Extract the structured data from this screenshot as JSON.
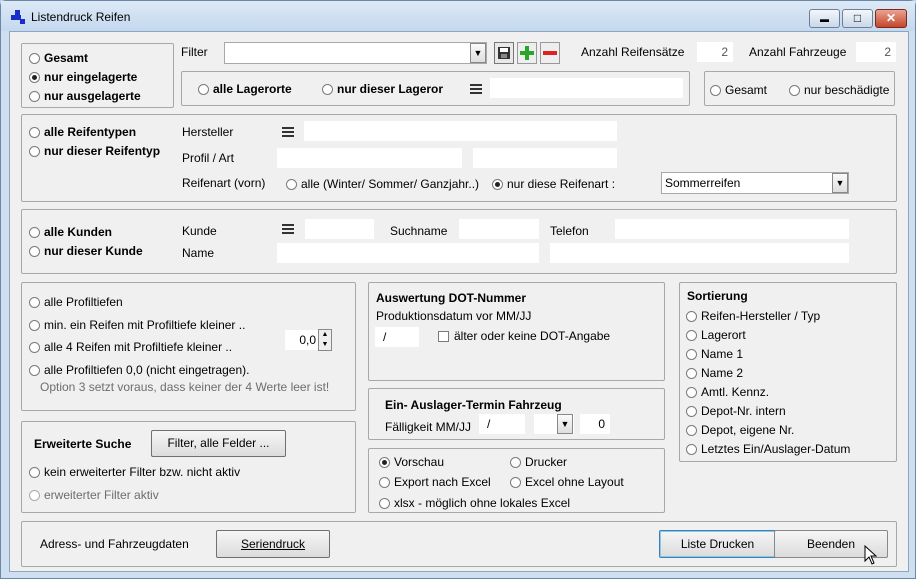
{
  "window": {
    "title": "Listendruck Reifen",
    "minimize": "▬",
    "maximize": "□",
    "close": "✕"
  },
  "scope": {
    "gesamt": "Gesamt",
    "eingelagert": "nur eingelagerte",
    "ausgelagert": "nur ausgelagerte",
    "selected": "eingelagert"
  },
  "filter": {
    "label": "Filter",
    "value": "",
    "save_icon": "floppy-disk",
    "add_icon": "plus",
    "remove_icon": "minus"
  },
  "counts": {
    "reifensaetze_label": "Anzahl Reifensätze",
    "reifensaetze_value": "2",
    "fahrzeuge_label": "Anzahl Fahrzeuge",
    "fahrzeuge_value": "2"
  },
  "lager": {
    "alle": "alle Lagerorte",
    "dieser": "nur dieser Lageror",
    "value": ""
  },
  "damage": {
    "gesamt": "Gesamt",
    "beschaedigt": "nur beschädigte"
  },
  "reifentyp": {
    "alle": "alle Reifentypen",
    "dieser": "nur dieser Reifentyp",
    "hersteller_label": "Hersteller",
    "profil_label": "Profil / Art",
    "reifenart_label": "Reifenart (vorn)",
    "alle_art": "alle (Winter/ Sommer/ Ganzjahr..)",
    "diese_art": "nur diese Reifenart :",
    "art_value": "Sommerreifen"
  },
  "kunden": {
    "alle": "alle Kunden",
    "dieser": "nur dieser Kunde",
    "kunde_label": "Kunde",
    "suchname_label": "Suchname",
    "telefon_label": "Telefon",
    "name_label": "Name"
  },
  "profil": {
    "alle": "alle Profiltiefen",
    "min_ein": "min. ein Reifen mit Profiltiefe kleiner ..",
    "alle4": "alle 4 Reifen mit Profiltiefe kleiner ..",
    "null": "alle Profiltiefen 0,0 (nicht eingetragen).",
    "hint": "Option 3 setzt voraus, dass keiner der 4 Werte leer ist!",
    "depth_value": "0,0"
  },
  "dot": {
    "title": "Auswertung DOT-Nummer",
    "sub": "Produktionsdatum vor MM/JJ",
    "value": "/",
    "older": "älter oder keine DOT-Angabe"
  },
  "termin": {
    "title": "Ein- Auslager-Termin Fahrzeug",
    "faellig_label": "Fälligkeit MM/JJ",
    "date_value": "/",
    "num_value": "0"
  },
  "sort": {
    "title": "Sortierung",
    "items": [
      "Reifen-Hersteller / Typ",
      "Lagerort",
      "Name 1",
      "Name 2",
      "Amtl. Kennz.",
      "Depot-Nr. intern",
      "Depot, eigene Nr.",
      "Letztes Ein/Auslager-Datum"
    ]
  },
  "erweitert": {
    "title": "Erweiterte Suche",
    "button": "Filter, alle Felder ...",
    "kein": "kein erweiterter Filter bzw. nicht aktiv",
    "aktiv": "erweiterter Filter aktiv"
  },
  "output": {
    "vorschau": "Vorschau",
    "drucker": "Drucker",
    "export": "Export nach Excel",
    "excel_ohne": "Excel ohne Layout",
    "xlsx": "xlsx - möglich ohne lokales Excel"
  },
  "footer": {
    "adress_label": "Adress- und Fahrzeugdaten",
    "serien": "Seriendruck",
    "drucken": "Liste Drucken",
    "beenden": "Beenden"
  }
}
